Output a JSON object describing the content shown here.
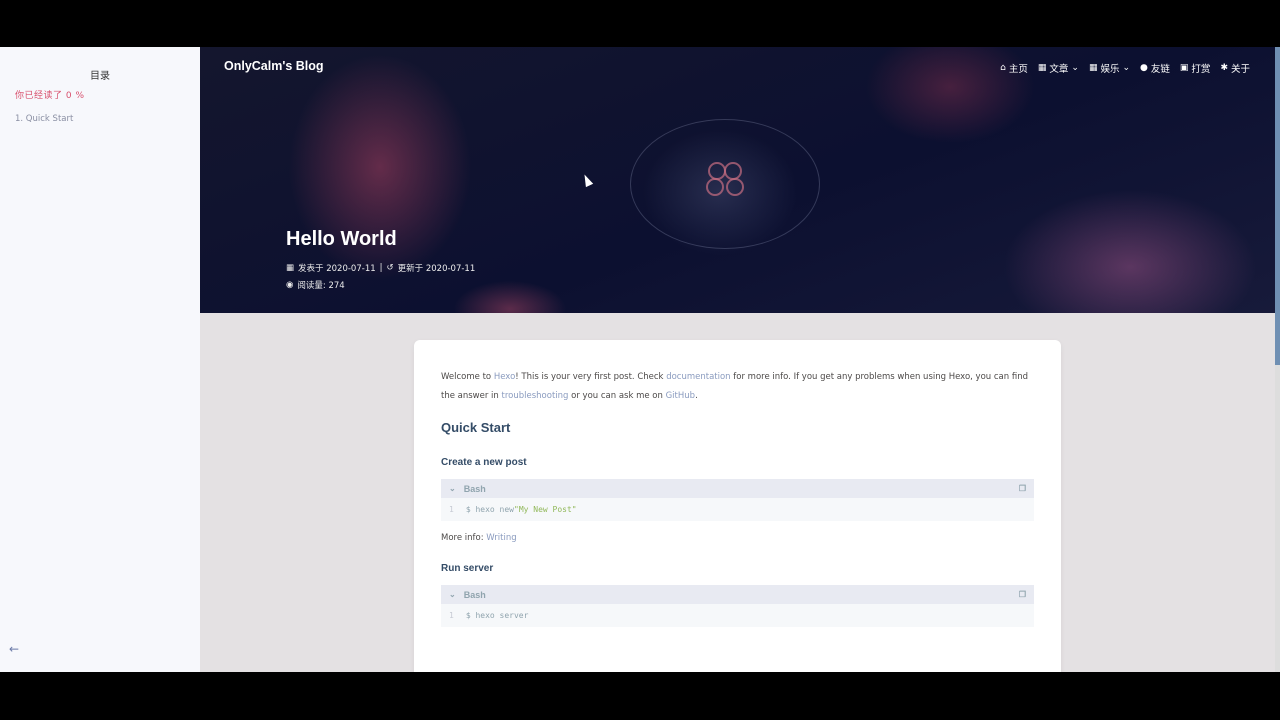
{
  "sidebar": {
    "toc_title": "目录",
    "progress_text": "你已经读了 0 %",
    "items": [
      {
        "label": "1. Quick Start"
      }
    ],
    "back_icon": "arrow-left-icon"
  },
  "header": {
    "site_name": "OnlyCalm's Blog",
    "menu": [
      {
        "icon": "home-icon",
        "label": "主页"
      },
      {
        "icon": "book-icon",
        "label": "文章",
        "dropdown": true
      },
      {
        "icon": "grid-icon",
        "label": "娱乐",
        "dropdown": true
      },
      {
        "icon": "users-icon",
        "label": "友链"
      },
      {
        "icon": "gift-icon",
        "label": "打赏"
      },
      {
        "icon": "paw-icon",
        "label": "关于"
      }
    ]
  },
  "post": {
    "title": "Hello World",
    "published": "发表于 2020-07-11",
    "separator": "|",
    "updated": "更新于 2020-07-11",
    "views": "阅读量: 274"
  },
  "content": {
    "intro_1": "Welcome to ",
    "link_hexo": "Hexo",
    "intro_2": "! This is your very first post. Check ",
    "link_docs": "documentation",
    "intro_3": " for more info. If you get any problems when using Hexo, you can find the answer in ",
    "link_trouble": "troubleshooting",
    "intro_4": " or you can ask me on ",
    "link_github": "GitHub",
    "intro_5": ".",
    "h2": "Quick Start",
    "section1": {
      "heading": "Create a new post",
      "lang": "Bash",
      "line_no": "1",
      "code_cmd": "$ hexo new ",
      "code_str": "\"My New Post\""
    },
    "more_info_label": "More info: ",
    "more_info_link": "Writing",
    "section2": {
      "heading": "Run server",
      "lang": "Bash",
      "line_no": "1",
      "code_cmd": "$ hexo server"
    }
  }
}
